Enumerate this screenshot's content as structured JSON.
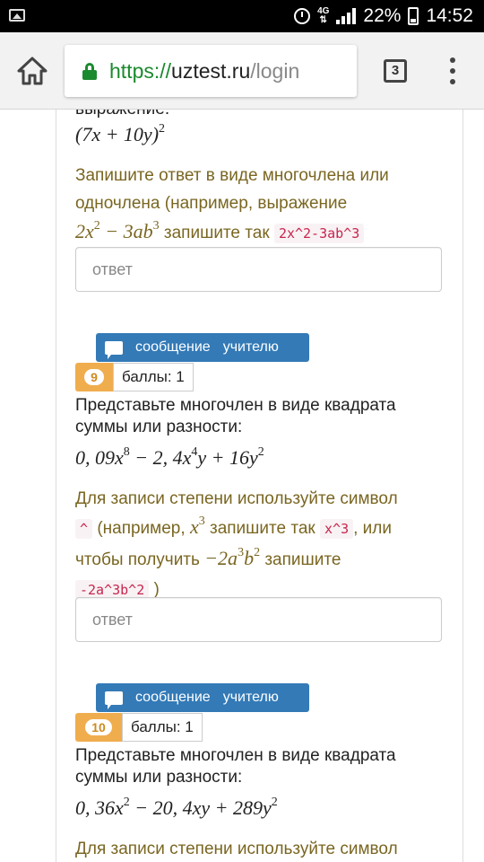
{
  "status_bar": {
    "network": "4G",
    "battery": "22%",
    "time": "14:52"
  },
  "browser": {
    "url_scheme": "https://",
    "url_host": "uztest.ru",
    "url_path": "/login",
    "tab_count": "3"
  },
  "q8": {
    "cut_text": "выражение:",
    "expr_base": "(7x + 10y)",
    "expr_exp": "2",
    "hint_line1": "Запишите ответ в виде многочлена или",
    "hint_line2": "одночлена (например, выражение",
    "hint_math_a": "2x",
    "hint_math_a_exp": "2",
    "hint_math_b": " − 3ab",
    "hint_math_b_exp": "3",
    "hint_mid": "запишите так",
    "hint_code": "2x^2-3ab^3",
    "answer_placeholder": "ответ"
  },
  "q9": {
    "msg_word1": "сообщение",
    "msg_word2": "учителю",
    "number": "9",
    "score": "баллы: 1",
    "text_line1": "Представьте многочлен в виде квадрата",
    "text_line2": "суммы или разности:",
    "expr_p1": "0, 09x",
    "expr_p1_exp": "8",
    "expr_p2": " − 2, 4x",
    "expr_p2_exp": "4",
    "expr_p3": "y + 16y",
    "expr_p3_exp": "2",
    "hint_line1": "Для записи степени используйте символ",
    "hint_code1": "^",
    "hint_a": "(например,",
    "hint_math_x": "x",
    "hint_math_x_exp": "3",
    "hint_b": "запишите так",
    "hint_code2": "x^3",
    "hint_c": ", или",
    "hint_d": "чтобы получить",
    "hint_math_m": "−2a",
    "hint_math_m_exp1": "3",
    "hint_math_b": "b",
    "hint_math_m_exp2": "2",
    "hint_e": "запишите",
    "hint_code3": "-2a^3b^2",
    "hint_close": ")",
    "answer_placeholder": "ответ"
  },
  "q10": {
    "msg_word1": "сообщение",
    "msg_word2": "учителю",
    "number": "10",
    "score": "баллы: 1",
    "text_line1": "Представьте многочлен в виде квадрата",
    "text_line2": "суммы или разности:",
    "expr_p1": "0, 36x",
    "expr_p1_exp": "2",
    "expr_p2": " − 20, 4xy + 289y",
    "expr_p2_exp": "2",
    "hint_line1": "Для записи степени используйте символ"
  }
}
